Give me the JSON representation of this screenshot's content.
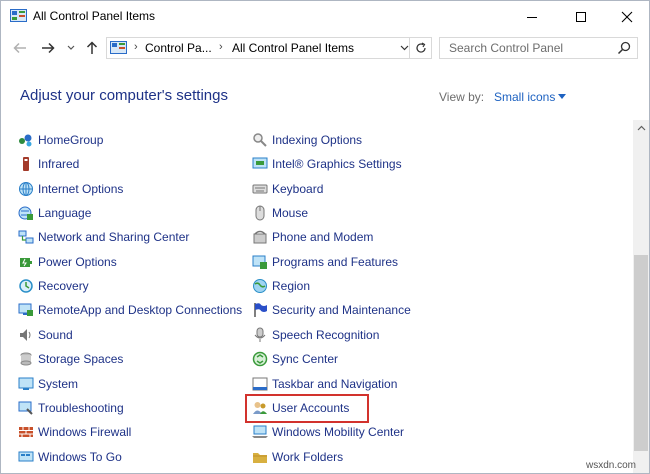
{
  "window": {
    "title": "All Control Panel Items",
    "controls": {
      "minimize": "—",
      "maximize": "☐",
      "close": "✕"
    }
  },
  "address": {
    "crumbs": [
      "Control Pa...",
      "All Control Panel Items"
    ],
    "separator": "›"
  },
  "search": {
    "placeholder": "Search Control Panel"
  },
  "main": {
    "heading": "Adjust your computer's settings",
    "view_by_label": "View by:",
    "view_by_value": "Small icons"
  },
  "items_left": [
    {
      "label": "HomeGroup",
      "icon": "homegroup-icon",
      "color": "#2d8a3e"
    },
    {
      "label": "Infrared",
      "icon": "infrared-icon",
      "color": "#a33a2a"
    },
    {
      "label": "Internet Options",
      "icon": "internet-options-icon",
      "color": "#2a7fc8"
    },
    {
      "label": "Language",
      "icon": "language-icon",
      "color": "#2a6cc8"
    },
    {
      "label": "Network and Sharing Center",
      "icon": "network-icon",
      "color": "#2a6cc8"
    },
    {
      "label": "Power Options",
      "icon": "power-options-icon",
      "color": "#3a9a3a"
    },
    {
      "label": "Recovery",
      "icon": "recovery-icon",
      "color": "#2a8fc8"
    },
    {
      "label": "RemoteApp and Desktop Connections",
      "icon": "remoteapp-icon",
      "color": "#2a6cc8"
    },
    {
      "label": "Sound",
      "icon": "sound-icon",
      "color": "#777777"
    },
    {
      "label": "Storage Spaces",
      "icon": "storage-spaces-icon",
      "color": "#8a8a8a"
    },
    {
      "label": "System",
      "icon": "system-icon",
      "color": "#2a7fc8"
    },
    {
      "label": "Troubleshooting",
      "icon": "troubleshooting-icon",
      "color": "#2a6cc8"
    },
    {
      "label": "Windows Firewall",
      "icon": "firewall-icon",
      "color": "#c8502a"
    },
    {
      "label": "Windows To Go",
      "icon": "windows-to-go-icon",
      "color": "#2a7fc8"
    }
  ],
  "items_right": [
    {
      "label": "Indexing Options",
      "icon": "indexing-options-icon",
      "color": "#888888"
    },
    {
      "label": "Intel® Graphics Settings",
      "icon": "intel-graphics-icon",
      "color": "#2a7fc8"
    },
    {
      "label": "Keyboard",
      "icon": "keyboard-icon",
      "color": "#777777"
    },
    {
      "label": "Mouse",
      "icon": "mouse-icon",
      "color": "#777777"
    },
    {
      "label": "Phone and Modem",
      "icon": "phone-modem-icon",
      "color": "#777777"
    },
    {
      "label": "Programs and Features",
      "icon": "programs-features-icon",
      "color": "#2a7fc8"
    },
    {
      "label": "Region",
      "icon": "region-icon",
      "color": "#2a8fc8"
    },
    {
      "label": "Security and Maintenance",
      "icon": "security-flag-icon",
      "color": "#2a4fc8"
    },
    {
      "label": "Speech Recognition",
      "icon": "speech-recognition-icon",
      "color": "#777777"
    },
    {
      "label": "Sync Center",
      "icon": "sync-center-icon",
      "color": "#3a9a3a"
    },
    {
      "label": "Taskbar and Navigation",
      "icon": "taskbar-icon",
      "color": "#2a6cc8"
    },
    {
      "label": "User Accounts",
      "icon": "user-accounts-icon",
      "color": "#c89a2a"
    },
    {
      "label": "Windows Mobility Center",
      "icon": "mobility-center-icon",
      "color": "#2a7fc8"
    },
    {
      "label": "Work Folders",
      "icon": "work-folders-icon",
      "color": "#d8b040"
    }
  ],
  "highlighted_item": "User Accounts",
  "watermark": "wsxdn.com",
  "colors": {
    "heading": "#1e3287",
    "link": "#1e3287",
    "view_by_value": "#1e62c1",
    "highlight_border": "#d2322d"
  }
}
